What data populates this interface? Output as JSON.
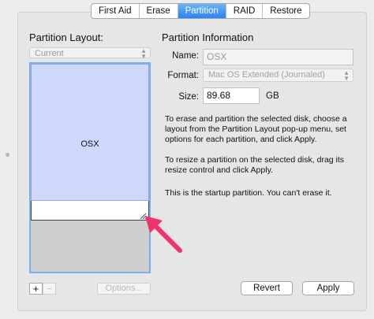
{
  "tabs": [
    {
      "label": "First Aid",
      "active": false
    },
    {
      "label": "Erase",
      "active": false
    },
    {
      "label": "Partition",
      "active": true
    },
    {
      "label": "RAID",
      "active": false
    },
    {
      "label": "Restore",
      "active": false
    }
  ],
  "layout": {
    "title": "Partition Layout:",
    "selected": "Current",
    "partition_name": "OSX",
    "add_label": "+",
    "remove_label": "−",
    "options_label": "Options..."
  },
  "info": {
    "title": "Partition Information",
    "name_label": "Name:",
    "name_value": "OSX",
    "format_label": "Format:",
    "format_value": "Mac OS Extended (Journaled)",
    "size_label": "Size:",
    "size_value": "89.68",
    "size_unit": "GB",
    "help1": "To erase and partition the selected disk, choose a layout from the Partition Layout pop-up menu, set options for each partition, and click Apply.",
    "help2": "To resize a partition on the selected disk, drag its resize control and click Apply.",
    "help3": "This is the startup partition. You can't erase it."
  },
  "buttons": {
    "revert": "Revert",
    "apply": "Apply"
  },
  "colors": {
    "accent": "#2a84f7",
    "partition_fill": "#cdd8fb",
    "annotation_arrow": "#f0336b"
  }
}
